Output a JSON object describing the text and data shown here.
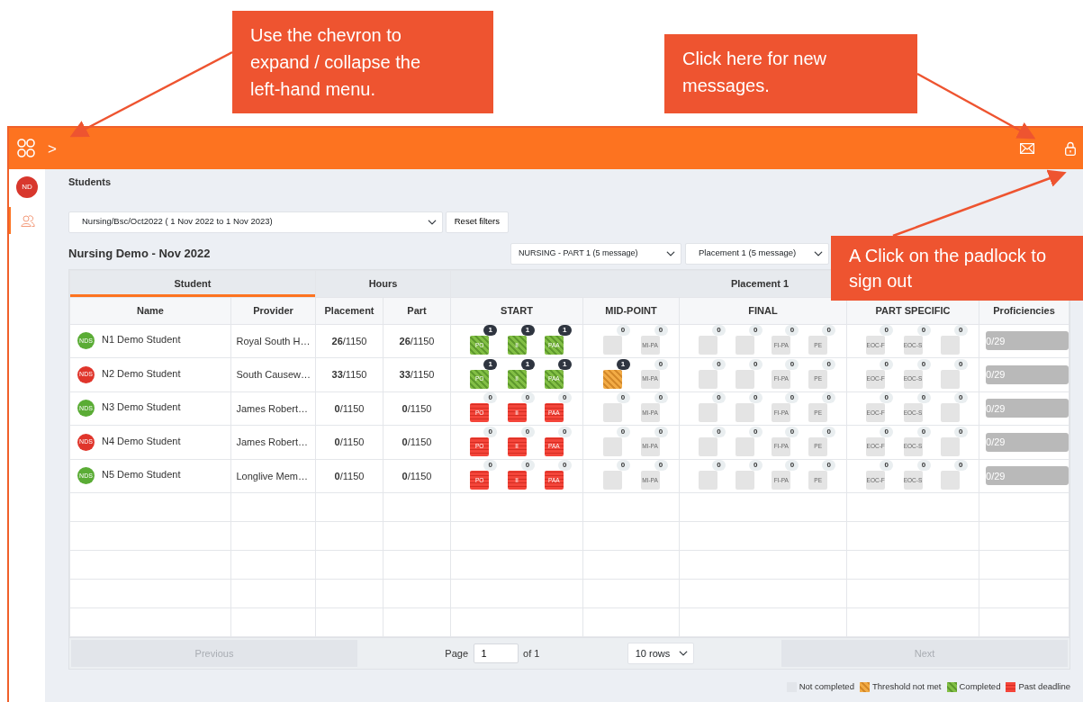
{
  "callouts": [
    {
      "text": "Use the chevron to expand / collapse the left-hand menu."
    },
    {
      "text": "Click here for new messages."
    },
    {
      "text": "A Click on the padlock to sign out"
    }
  ],
  "header": {
    "chevron": ">"
  },
  "user": {
    "initials": "ND"
  },
  "page_title": "Students",
  "filters": {
    "cohort": "Nursing/Bsc/Oct2022 ( 1 Nov 2022 to 1 Nov 2023)",
    "reset": "Reset filters"
  },
  "group_title": "Nursing Demo - Nov 2022",
  "part_select": "NURSING - PART 1 (5 message)",
  "placement_select": "Placement 1 (5 message)",
  "table": {
    "group_headers": [
      "Student",
      "Hours",
      "Placement 1"
    ],
    "columns": [
      "Name",
      "Provider",
      "Placement",
      "Part",
      "START",
      "MID-POINT",
      "FINAL",
      "PART SPECIFIC",
      "Proficiencies"
    ],
    "rows": [
      {
        "initials": "NDS",
        "color": "#5aac35",
        "name": "N1 Demo Student",
        "provider": "Royal South H…",
        "placement": "**26**/1150",
        "part": "**26**/1150",
        "tiles": [
          [
            {
              "label": "PO",
              "count": "1",
              "kind": "completed"
            },
            {
              "label": "II",
              "count": "1",
              "kind": "completed"
            },
            {
              "label": "PAA",
              "count": "1",
              "kind": "completed"
            }
          ],
          [
            {
              "count": "0",
              "kind": "not"
            },
            {
              "label": "MI-PA",
              "count": "0",
              "kind": "not"
            }
          ],
          [
            {
              "count": "0",
              "kind": "not"
            },
            {
              "count": "0",
              "kind": "not"
            },
            {
              "label": "FI-PA",
              "count": "0",
              "kind": "not"
            },
            {
              "label": "PE",
              "count": "0",
              "kind": "not"
            }
          ],
          [
            {
              "label": "EOC-F",
              "count": "0",
              "kind": "not"
            },
            {
              "label": "EOC-S",
              "count": "0",
              "kind": "not"
            },
            {
              "count": "0",
              "kind": "not"
            }
          ]
        ],
        "proficiencies": "0/29"
      },
      {
        "initials": "NDS",
        "color": "#e0352b",
        "name": "N2 Demo Student",
        "provider": "South Causew…",
        "placement": "**33**/1150",
        "part": "**33**/1150",
        "tiles": [
          [
            {
              "label": "PO",
              "count": "1",
              "kind": "completed"
            },
            {
              "label": "II",
              "count": "1",
              "kind": "completed"
            },
            {
              "label": "PAA",
              "count": "1",
              "kind": "completed"
            }
          ],
          [
            {
              "count": "1",
              "kind": "threshold"
            },
            {
              "label": "MI-PA",
              "count": "0",
              "kind": "not"
            }
          ],
          [
            {
              "count": "0",
              "kind": "not"
            },
            {
              "count": "0",
              "kind": "not"
            },
            {
              "label": "FI-PA",
              "count": "0",
              "kind": "not"
            },
            {
              "label": "PE",
              "count": "0",
              "kind": "not"
            }
          ],
          [
            {
              "label": "EOC-F",
              "count": "0",
              "kind": "not"
            },
            {
              "label": "EOC-S",
              "count": "0",
              "kind": "not"
            },
            {
              "count": "0",
              "kind": "not"
            }
          ]
        ],
        "proficiencies": "0/29"
      },
      {
        "initials": "NDS",
        "color": "#5aac35",
        "name": "N3 Demo Student",
        "provider": "James Robert…",
        "placement": "**0**/1150",
        "part": "**0**/1150",
        "tiles": [
          [
            {
              "label": "PO",
              "count": "0",
              "kind": "past"
            },
            {
              "label": "II",
              "count": "0",
              "kind": "past"
            },
            {
              "label": "PAA",
              "count": "0",
              "kind": "past"
            }
          ],
          [
            {
              "count": "0",
              "kind": "not"
            },
            {
              "label": "MI-PA",
              "count": "0",
              "kind": "not"
            }
          ],
          [
            {
              "count": "0",
              "kind": "not"
            },
            {
              "count": "0",
              "kind": "not"
            },
            {
              "label": "FI-PA",
              "count": "0",
              "kind": "not"
            },
            {
              "label": "PE",
              "count": "0",
              "kind": "not"
            }
          ],
          [
            {
              "label": "EOC-F",
              "count": "0",
              "kind": "not"
            },
            {
              "label": "EOC-S",
              "count": "0",
              "kind": "not"
            },
            {
              "count": "0",
              "kind": "not"
            }
          ]
        ],
        "proficiencies": "0/29"
      },
      {
        "initials": "NDS",
        "color": "#e0352b",
        "name": "N4 Demo Student",
        "provider": "James Robert…",
        "placement": "**0**/1150",
        "part": "**0**/1150",
        "tiles": [
          [
            {
              "label": "PO",
              "count": "0",
              "kind": "past"
            },
            {
              "label": "II",
              "count": "0",
              "kind": "past"
            },
            {
              "label": "PAA",
              "count": "0",
              "kind": "past"
            }
          ],
          [
            {
              "count": "0",
              "kind": "not"
            },
            {
              "label": "MI-PA",
              "count": "0",
              "kind": "not"
            }
          ],
          [
            {
              "count": "0",
              "kind": "not"
            },
            {
              "count": "0",
              "kind": "not"
            },
            {
              "label": "FI-PA",
              "count": "0",
              "kind": "not"
            },
            {
              "label": "PE",
              "count": "0",
              "kind": "not"
            }
          ],
          [
            {
              "label": "EOC-F",
              "count": "0",
              "kind": "not"
            },
            {
              "label": "EOC-S",
              "count": "0",
              "kind": "not"
            },
            {
              "count": "0",
              "kind": "not"
            }
          ]
        ],
        "proficiencies": "0/29"
      },
      {
        "initials": "NDS",
        "color": "#5aac35",
        "name": "N5 Demo Student",
        "provider": "Longlive Mem…",
        "placement": "**0**/1150",
        "part": "**0**/1150",
        "tiles": [
          [
            {
              "label": "PO",
              "count": "0",
              "kind": "past"
            },
            {
              "label": "II",
              "count": "0",
              "kind": "past"
            },
            {
              "label": "PAA",
              "count": "0",
              "kind": "past"
            }
          ],
          [
            {
              "count": "0",
              "kind": "not"
            },
            {
              "label": "MI-PA",
              "count": "0",
              "kind": "not"
            }
          ],
          [
            {
              "count": "0",
              "kind": "not"
            },
            {
              "count": "0",
              "kind": "not"
            },
            {
              "label": "FI-PA",
              "count": "0",
              "kind": "not"
            },
            {
              "label": "PE",
              "count": "0",
              "kind": "not"
            }
          ],
          [
            {
              "label": "EOC-F",
              "count": "0",
              "kind": "not"
            },
            {
              "label": "EOC-S",
              "count": "0",
              "kind": "not"
            },
            {
              "count": "0",
              "kind": "not"
            }
          ]
        ],
        "proficiencies": "0/29"
      }
    ]
  },
  "pagination": {
    "previous": "Previous",
    "page_label": "Page",
    "page": "1",
    "of": "of 1",
    "rows": "10 rows",
    "next": "Next"
  },
  "legend": [
    {
      "label": "Not completed",
      "kind": "not"
    },
    {
      "label": "Threshold not met",
      "kind": "threshold"
    },
    {
      "label": "Completed",
      "kind": "completed"
    },
    {
      "label": "Past deadline",
      "kind": "past"
    }
  ]
}
